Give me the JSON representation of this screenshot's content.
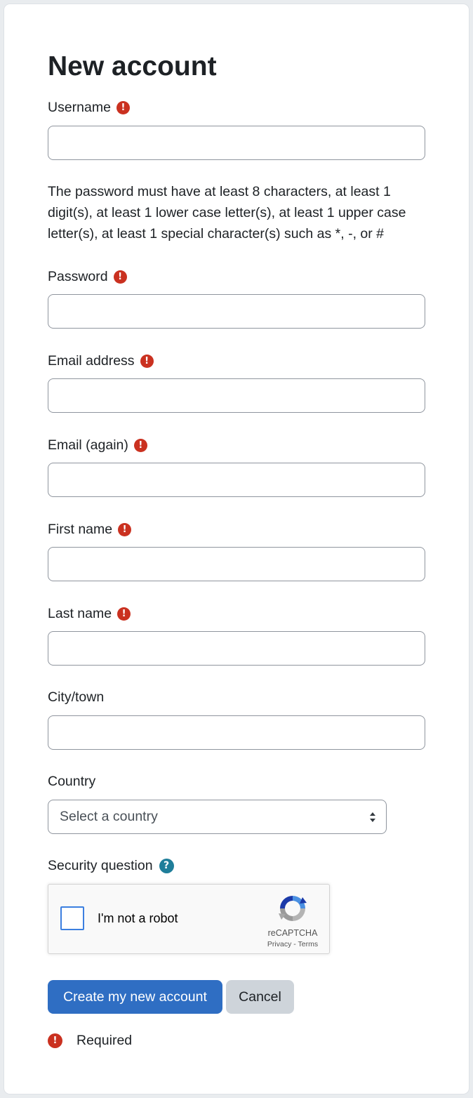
{
  "form": {
    "title": "New account",
    "password_hint": "The password must have at least 8 characters, at least 1 digit(s), at least 1 lower case letter(s), at least 1 upper case letter(s), at least 1 special character(s) such as *, -, or #",
    "fields": {
      "username": {
        "label": "Username",
        "value": ""
      },
      "password": {
        "label": "Password",
        "value": ""
      },
      "email": {
        "label": "Email address",
        "value": ""
      },
      "email_again": {
        "label": "Email (again)",
        "value": ""
      },
      "first_name": {
        "label": "First name",
        "value": ""
      },
      "last_name": {
        "label": "Last name",
        "value": ""
      },
      "city": {
        "label": "City/town",
        "value": ""
      },
      "country": {
        "label": "Country",
        "selected": "Select a country"
      },
      "security_question": {
        "label": "Security question"
      }
    },
    "recaptcha": {
      "checkbox_label": "I'm not a robot",
      "brand": "reCAPTCHA",
      "privacy": "Privacy",
      "separator": " - ",
      "terms": "Terms"
    },
    "buttons": {
      "submit": "Create my new account",
      "cancel": "Cancel"
    },
    "legend": {
      "required": "Required"
    },
    "icons": {
      "required": "exclamation-icon",
      "help": "question-icon"
    },
    "colors": {
      "primary": "#2f6ec3",
      "required": "#ca3120",
      "help": "#1f7e9a"
    }
  }
}
